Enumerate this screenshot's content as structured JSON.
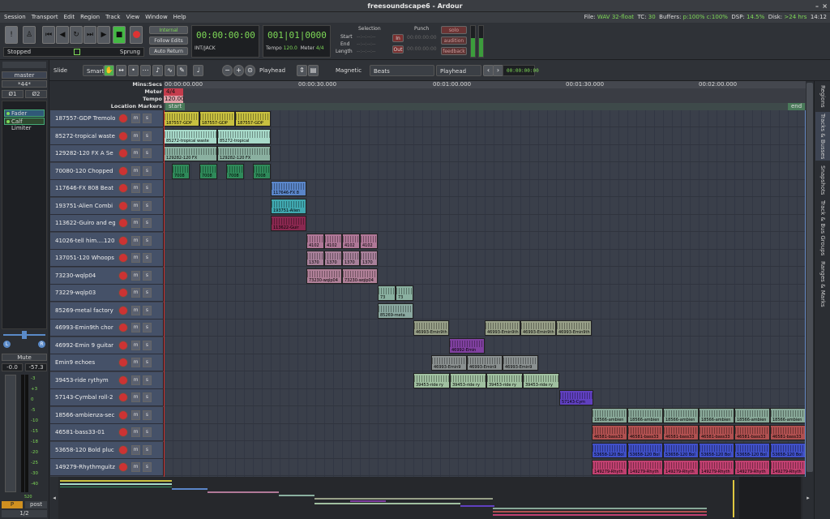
{
  "window": {
    "title": "freesoundscape6 - Ardour"
  },
  "menu": [
    "Session",
    "Transport",
    "Edit",
    "Region",
    "Track",
    "View",
    "Window",
    "Help"
  ],
  "status": {
    "file_label": "File:",
    "file": "WAV 32-float",
    "tc_label": "TC:",
    "tc": "30",
    "buffers_label": "Buffers:",
    "buffers": "p:100% c:100%",
    "dsp_label": "DSP:",
    "dsp": "14.5%",
    "disk_label": "Disk:",
    "disk": ">24 hrs",
    "time": "14:12"
  },
  "transport": {
    "internal": "Internal",
    "follow_edits": "Follow Edits",
    "auto_return": "Auto Return",
    "clock_primary": "00:00:00:00",
    "clock_sub": "INT/JACK",
    "bbt": "001|01|0000",
    "tempo_label": "Tempo",
    "tempo": "120.0",
    "meter_label": "Meter",
    "meter": "4/4",
    "stopped": "Stopped",
    "sprung": "Sprung"
  },
  "selection": {
    "title": "Selection",
    "start_label": "Start",
    "end_label": "End",
    "length_label": "Length",
    "value": "--:--:--:--"
  },
  "punch": {
    "title": "Punch",
    "in": "In",
    "out": "Out",
    "value": "00:00:00:00"
  },
  "buttons": {
    "solo": "solo",
    "audition": "audition",
    "feedback": "feedback"
  },
  "edit_toolbar": {
    "mode": "Slide",
    "grab": "Smart",
    "zoom_focus": "Playhead",
    "snap": "Magnetic",
    "grid": "Beats",
    "edit_point": "Playhead",
    "nudge_clock": "00:00:00:00"
  },
  "mixer_strip": {
    "name": "master",
    "input": "*44*",
    "in1": "Ø1",
    "in2": "Ø2",
    "plugins": [
      "Fader",
      "Calf Limiter"
    ],
    "mute": "Mute",
    "gain": "-0.0",
    "peak": "-57.3",
    "meter_scale": [
      "-3",
      "+3",
      "0",
      "-5",
      "-10",
      "-15",
      "-18",
      "-20",
      "-25",
      "-30",
      "-40"
    ],
    "meter_bottom": "520",
    "pre": "P",
    "post": "post",
    "ratio": "1/2"
  },
  "rulers": {
    "labels": [
      "Mins:Secs",
      "Meter",
      "Tempo",
      "Location Markers"
    ],
    "times": [
      "00:00:00.000",
      "00:00:30.000",
      "00:01:00.000",
      "00:01:30.000",
      "00:02:00.000"
    ],
    "meter": "4/4",
    "tempo": "120.00",
    "marker_start": "start",
    "marker_end": "end"
  },
  "tracks": [
    {
      "name": "187557-GDP Tremolo",
      "color": "#c8c040",
      "regions": [
        {
          "s": 0,
          "w": 44,
          "l": "187557-GDP"
        },
        {
          "s": 44,
          "w": 44,
          "l": "187557-GDP"
        },
        {
          "s": 88,
          "w": 44,
          "l": "187557-GDP"
        }
      ]
    },
    {
      "name": "85272-tropical waste",
      "color": "#a7d9c9",
      "regions": [
        {
          "s": 0,
          "w": 66,
          "l": "85272-tropical waste"
        },
        {
          "s": 66,
          "w": 66,
          "l": "85272-tropical"
        }
      ]
    },
    {
      "name": "129282-120 FX A Se",
      "color": "#8ab0a0",
      "regions": [
        {
          "s": 0,
          "w": 66,
          "l": "129282-120 FX"
        },
        {
          "s": 66,
          "w": 66,
          "l": "129282-120 FX"
        }
      ]
    },
    {
      "name": "70080-120 Chopped",
      "color": "#2f8a5a",
      "regions": [
        {
          "s": 10,
          "w": 22,
          "l": "7008"
        },
        {
          "s": 44,
          "w": 22,
          "l": "7008"
        },
        {
          "s": 77,
          "w": 22,
          "l": "7008"
        },
        {
          "s": 110,
          "w": 22,
          "l": "7008"
        }
      ]
    },
    {
      "name": "117646-FX 808 Beat",
      "color": "#5a85c8",
      "regions": [
        {
          "s": 132,
          "w": 44,
          "l": "117646-FX 8"
        }
      ]
    },
    {
      "name": "193751-Alien Combi",
      "color": "#40a8b0",
      "regions": [
        {
          "s": 132,
          "w": 44,
          "l": "193751-Alien"
        }
      ]
    },
    {
      "name": "113622-Guiro and eg",
      "color": "#8a2850",
      "regions": [
        {
          "s": 132,
          "w": 44,
          "l": "113622-Guir"
        }
      ]
    },
    {
      "name": "41026-tell him....120",
      "color": "#b07898",
      "regions": [
        {
          "s": 176,
          "w": 22,
          "l": "4102"
        },
        {
          "s": 198,
          "w": 22,
          "l": "4102"
        },
        {
          "s": 220,
          "w": 22,
          "l": "4102"
        },
        {
          "s": 242,
          "w": 22,
          "l": "4102"
        }
      ]
    },
    {
      "name": "137051-120 Whoops",
      "color": "#a8809a",
      "regions": [
        {
          "s": 176,
          "w": 22,
          "l": "1370"
        },
        {
          "s": 198,
          "w": 22,
          "l": "1370"
        },
        {
          "s": 220,
          "w": 22,
          "l": "1370"
        },
        {
          "s": 242,
          "w": 22,
          "l": "1370"
        }
      ]
    },
    {
      "name": "73230-wqlp04",
      "color": "#b08098",
      "regions": [
        {
          "s": 176,
          "w": 44,
          "l": "73230-wqlp04"
        },
        {
          "s": 220,
          "w": 44,
          "l": "73230-wqlp04"
        }
      ]
    },
    {
      "name": "73229-wqlp03",
      "color": "#8ab0a0",
      "regions": [
        {
          "s": 264,
          "w": 22,
          "l": "73"
        },
        {
          "s": 286,
          "w": 22,
          "l": "73"
        }
      ]
    },
    {
      "name": "85269-metal factory",
      "color": "#8aa8a0",
      "regions": [
        {
          "s": 264,
          "w": 44,
          "l": "85269-meta"
        }
      ]
    },
    {
      "name": "46993-Emin9th chor",
      "color": "#98a088",
      "regions": [
        {
          "s": 308,
          "w": 44,
          "l": "46993-Emin9th"
        },
        {
          "s": 396,
          "w": 44,
          "l": "46993-Emin9th"
        },
        {
          "s": 440,
          "w": 44,
          "l": "46993-Emin9th"
        },
        {
          "s": 484,
          "w": 44,
          "l": "46993-Emin9th"
        }
      ]
    },
    {
      "name": "46992-Emin 9 guitar",
      "color": "#8040a0",
      "regions": [
        {
          "s": 352,
          "w": 44,
          "l": "46992-Emin"
        }
      ]
    },
    {
      "name": "Emin9 echoes",
      "color": "#8a9090",
      "regions": [
        {
          "s": 330,
          "w": 44,
          "l": "46993-Emin9"
        },
        {
          "s": 374,
          "w": 44,
          "l": "46993-Emin9"
        },
        {
          "s": 418,
          "w": 44,
          "l": "46993-Emin9"
        }
      ]
    },
    {
      "name": "39453-ride rythym",
      "color": "#a0c0a0",
      "regions": [
        {
          "s": 308,
          "w": 45,
          "l": "39453-ride ry"
        },
        {
          "s": 353,
          "w": 45,
          "l": "39453-ride ry"
        },
        {
          "s": 398,
          "w": 45,
          "l": "39453-ride ry"
        },
        {
          "s": 443,
          "w": 45,
          "l": "39453-ride ry"
        }
      ]
    },
    {
      "name": "57143-Cymbal roll-2",
      "color": "#6040c0",
      "regions": [
        {
          "s": 488,
          "w": 42,
          "l": "57143-Cym"
        }
      ]
    },
    {
      "name": "18566-ambienza-sec",
      "color": "#88a898",
      "regions": [
        {
          "s": 528,
          "w": 44,
          "l": "18566-ambien"
        },
        {
          "s": 572,
          "w": 44,
          "l": "18566-ambien"
        },
        {
          "s": 616,
          "w": 44,
          "l": "18566-ambien"
        },
        {
          "s": 660,
          "w": 44,
          "l": "18566-ambien"
        },
        {
          "s": 704,
          "w": 44,
          "l": "18566-ambien"
        },
        {
          "s": 748,
          "w": 44,
          "l": "18566-ambien"
        }
      ]
    },
    {
      "name": "46581-bass33-01",
      "color": "#b05050",
      "regions": [
        {
          "s": 528,
          "w": 44,
          "l": "46581-bass33"
        },
        {
          "s": 572,
          "w": 44,
          "l": "46581-bass33"
        },
        {
          "s": 616,
          "w": 44,
          "l": "46581-bass33"
        },
        {
          "s": 660,
          "w": 44,
          "l": "46581-bass33"
        },
        {
          "s": 704,
          "w": 44,
          "l": "46581-bass33"
        },
        {
          "s": 748,
          "w": 44,
          "l": "46581-bass33"
        }
      ]
    },
    {
      "name": "53658-120 Bold pluc",
      "color": "#4050c8",
      "regions": [
        {
          "s": 528,
          "w": 44,
          "l": "53658-120 Bol"
        },
        {
          "s": 572,
          "w": 44,
          "l": "53658-120 Bol"
        },
        {
          "s": 616,
          "w": 44,
          "l": "53658-120 Bol"
        },
        {
          "s": 660,
          "w": 44,
          "l": "53658-120 Bol"
        },
        {
          "s": 704,
          "w": 44,
          "l": "53658-120 Bol"
        },
        {
          "s": 748,
          "w": 44,
          "l": "53658-120 Bol"
        }
      ]
    },
    {
      "name": "149279-Rhythmguitz",
      "color": "#c04070",
      "regions": [
        {
          "s": 528,
          "w": 44,
          "l": "149279-Rhyth"
        },
        {
          "s": 572,
          "w": 44,
          "l": "149279-Rhyth"
        },
        {
          "s": 616,
          "w": 44,
          "l": "149279-Rhyth"
        },
        {
          "s": 660,
          "w": 44,
          "l": "149279-Rhyth"
        },
        {
          "s": 704,
          "w": 44,
          "l": "149279-Rhyth"
        },
        {
          "s": 748,
          "w": 44,
          "l": "149279-Rhyth"
        }
      ]
    }
  ],
  "track_buttons": {
    "mute": "m",
    "solo": "s"
  },
  "side_tabs": [
    "Regions",
    "Tracks & Busses",
    "Snapshots",
    "Track & Bus Groups",
    "Ranges & Marks"
  ]
}
